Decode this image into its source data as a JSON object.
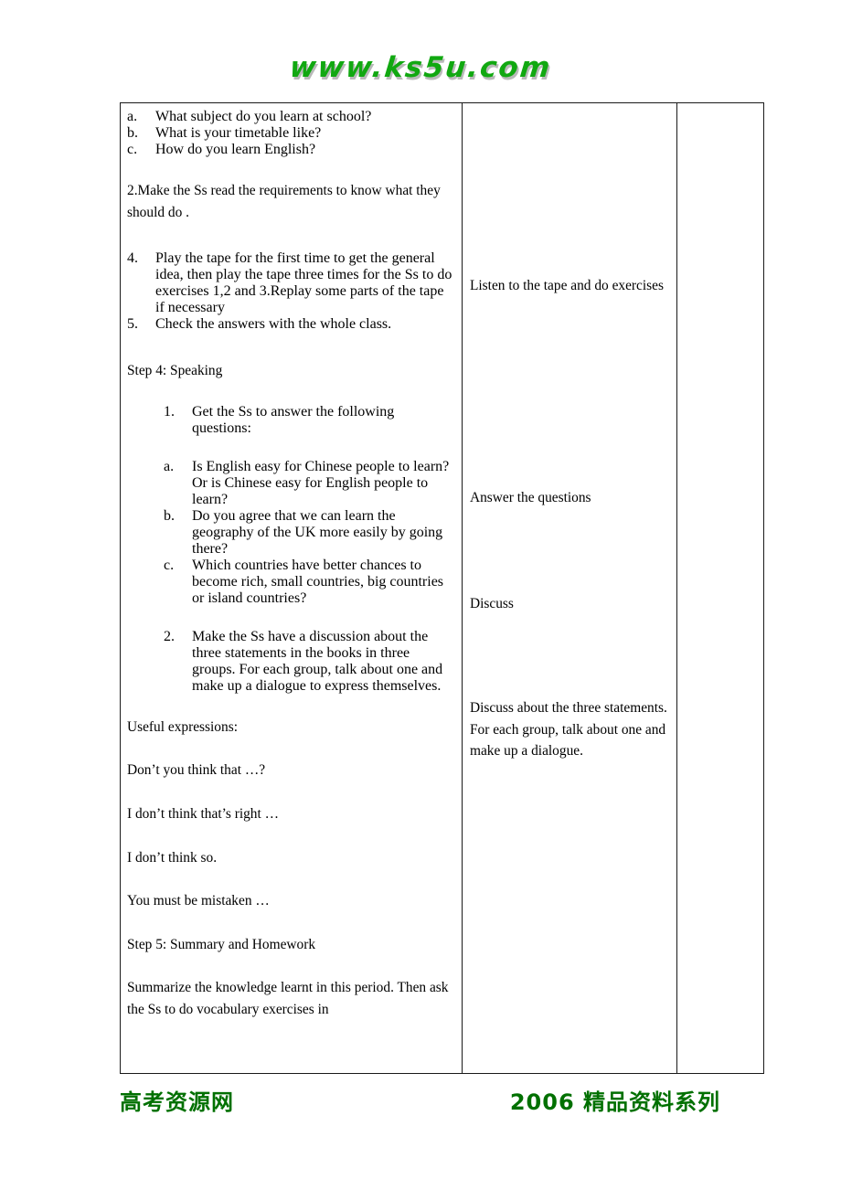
{
  "header": {
    "logo_text": "www.ks5u.com"
  },
  "document": {
    "left_column": {
      "question_list_1": [
        {
          "marker": "a.",
          "text": "What subject do you learn at school?"
        },
        {
          "marker": "b.",
          "text": "What is your timetable like?"
        },
        {
          "marker": "c.",
          "text": "How do you learn English?"
        }
      ],
      "paragraph_requirements": "2.Make the Ss read the requirements to know what they should do .",
      "step3_list": [
        {
          "marker": "4.",
          "text": "Play the tape for the first time to get the general idea, then play the tape three times for the Ss to do exercises 1,2 and 3.Replay some parts of the tape if necessary"
        },
        {
          "marker": "5.",
          "text": "Check the answers with the whole class."
        }
      ],
      "step4_heading": "Step 4: Speaking",
      "step4_item_1": {
        "marker": "1.",
        "text": "Get the Ss to answer the following questions:"
      },
      "step4_questions": [
        {
          "marker": "a.",
          "text": "Is English easy for Chinese people to learn? Or is Chinese easy for English people to learn?"
        },
        {
          "marker": "b.",
          "text": "Do you agree that we can learn the geography of the UK more easily by going there?"
        },
        {
          "marker": "c.",
          "text": "Which countries have better chances to become rich, small countries, big countries or island countries?"
        }
      ],
      "step4_item_2": {
        "marker": "2.",
        "text": "Make the Ss have a discussion about the three statements in the books in three groups. For each group, talk about one and make up a dialogue to express   themselves."
      },
      "useful_expressions_label": "Useful expressions:",
      "useful_expressions": [
        "Don’t you think that …?",
        "I don’t think that’s right …",
        "I don’t think so.",
        "You must be mistaken …"
      ],
      "step5_heading": "Step 5: Summary and Homework",
      "step5_text": "Summarize the knowledge learnt in this period. Then ask the Ss to do   vocabulary exercises in"
    },
    "middle_column": {
      "note_listen": "Listen to the tape and do exercises",
      "note_answer": "Answer the questions",
      "note_discuss": "Discuss",
      "note_discuss_long": "Discuss about the three statements. For each group, talk about one and make up a dialogue."
    },
    "right_column": {
      "content": ""
    }
  },
  "footer": {
    "left_text": "高考资源网",
    "right_text": "2006 精品资料系列"
  },
  "colors": {
    "logo_green": "#11a811",
    "footer_green": "#007000",
    "border": "#1a1a1a"
  }
}
